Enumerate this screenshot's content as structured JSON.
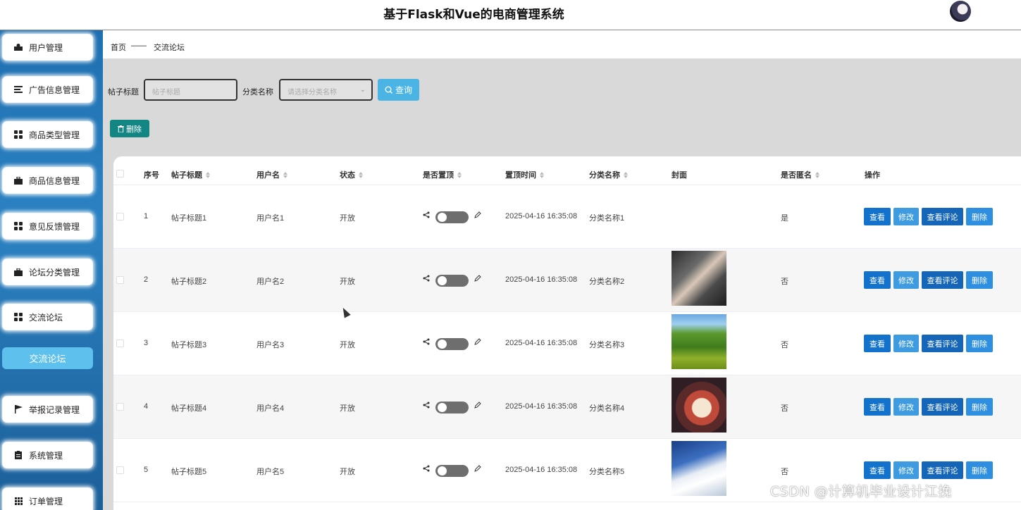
{
  "header": {
    "title": "基于Flask和Vue的电商管理系统"
  },
  "sidebar": {
    "items": [
      {
        "label": "用户管理",
        "icon": "user-icon"
      },
      {
        "label": "广告信息管理",
        "icon": "list-icon"
      },
      {
        "label": "商品类型管理",
        "icon": "grid-icon"
      },
      {
        "label": "商品信息管理",
        "icon": "briefcase-icon"
      },
      {
        "label": "意见反馈管理",
        "icon": "grid-icon"
      },
      {
        "label": "论坛分类管理",
        "icon": "briefcase-icon"
      },
      {
        "label": "交流论坛",
        "icon": "grid-icon"
      },
      {
        "label": "交流论坛",
        "icon": ""
      },
      {
        "label": "举报记录管理",
        "icon": "flag-icon"
      },
      {
        "label": "系统管理",
        "icon": "clipboard-icon"
      },
      {
        "label": "订单管理",
        "icon": "grid9-icon"
      }
    ]
  },
  "breadcrumb": {
    "home": "首页",
    "separator": "——",
    "current": "交流论坛"
  },
  "filters": {
    "title_label": "帖子标题",
    "title_placeholder": "帖子标题",
    "category_label": "分类名称",
    "category_placeholder": "请选择分类名称",
    "query_label": "查询"
  },
  "toolbar": {
    "delete_label": "删除"
  },
  "table": {
    "headers": {
      "index": "序号",
      "title": "帖子标题",
      "user": "用户名",
      "status": "状态",
      "pinned": "是否置顶",
      "pin_time": "置顶时间",
      "category": "分类名称",
      "cover": "封面",
      "anonymous": "是否匿名",
      "actions": "操作"
    },
    "rows": [
      {
        "index": "1",
        "title": "帖子标题1",
        "user": "用户名1",
        "status": "开放",
        "pin_time": "2025-04-16 16:35:08",
        "category": "分类名称1",
        "cover": "",
        "anonymous": "是"
      },
      {
        "index": "2",
        "title": "帖子标题2",
        "user": "用户名2",
        "status": "开放",
        "pin_time": "2025-04-16 16:35:08",
        "category": "分类名称2",
        "cover": "fitness-photo",
        "anonymous": "否"
      },
      {
        "index": "3",
        "title": "帖子标题3",
        "user": "用户名3",
        "status": "开放",
        "pin_time": "2025-04-16 16:35:08",
        "category": "分类名称3",
        "cover": "landscape-photo",
        "anonymous": "否"
      },
      {
        "index": "4",
        "title": "帖子标题4",
        "user": "用户名4",
        "status": "开放",
        "pin_time": "2025-04-16 16:35:08",
        "category": "分类名称4",
        "cover": "cake-photo",
        "anonymous": "否"
      },
      {
        "index": "5",
        "title": "帖子标题5",
        "user": "用户名5",
        "status": "开放",
        "pin_time": "2025-04-16 16:35:08",
        "category": "分类名称5",
        "cover": "ski-photo",
        "anonymous": "否"
      }
    ],
    "actions": {
      "view": "查看",
      "edit": "修改",
      "view_comments": "查看评论",
      "delete": "删除"
    }
  },
  "colors": {
    "view_button": "#1272cc",
    "edit_button": "#3e9be0",
    "comments_button": "#1566b8",
    "delete_button": "#2e8ee0",
    "delete_toolbar_button": "#138683",
    "query_button": "#4ab4e5",
    "sidebar_active": "#5ec0ec"
  },
  "watermark": "CSDN @计算机毕业设计江挽"
}
